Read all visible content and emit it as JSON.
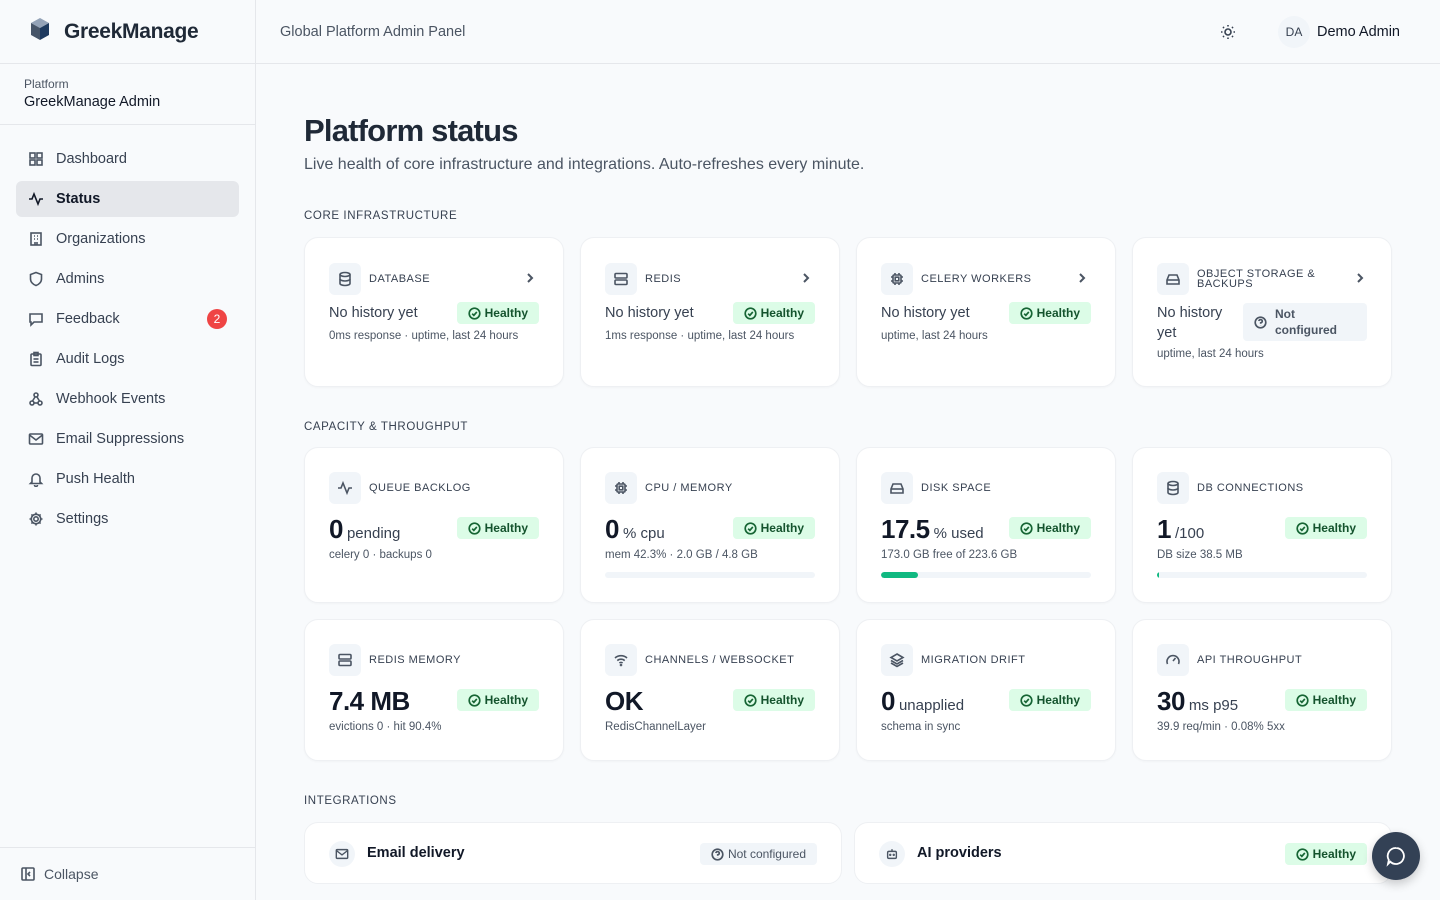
{
  "app": {
    "brand": "GreekManage",
    "org_label": "Platform",
    "org_name": "GreekManage Admin"
  },
  "sidebar": {
    "items": [
      {
        "label": "Dashboard",
        "icon": "grid-icon"
      },
      {
        "label": "Status",
        "icon": "activity-icon",
        "active": true
      },
      {
        "label": "Organizations",
        "icon": "building-icon"
      },
      {
        "label": "Admins",
        "icon": "shield-icon"
      },
      {
        "label": "Feedback",
        "icon": "message-icon",
        "badge": "2"
      },
      {
        "label": "Audit Logs",
        "icon": "clipboard-icon"
      },
      {
        "label": "Webhook Events",
        "icon": "webhook-icon"
      },
      {
        "label": "Email Suppressions",
        "icon": "mail-x-icon"
      },
      {
        "label": "Push Health",
        "icon": "bell-icon"
      },
      {
        "label": "Settings",
        "icon": "gear-icon"
      }
    ],
    "collapse_label": "Collapse"
  },
  "header": {
    "title": "Global Platform Admin Panel",
    "avatar_initials": "DA",
    "user_name": "Demo Admin"
  },
  "page": {
    "title": "Platform status",
    "subtitle": "Live health of core infrastructure and integrations. Auto-refreshes every minute."
  },
  "sections": {
    "core": "CORE INFRASTRUCTURE",
    "capacity": "CAPACITY & THROUGHPUT",
    "integrations": "INTEGRATIONS"
  },
  "core_cards": [
    {
      "label": "DATABASE",
      "status_text": "No history yet",
      "pill": "Healthy",
      "detail": "0ms response · uptime, last 24 hours"
    },
    {
      "label": "REDIS",
      "status_text": "No history yet",
      "pill": "Healthy",
      "detail": "1ms response · uptime, last 24 hours"
    },
    {
      "label": "CELERY WORKERS",
      "status_text": "No history yet",
      "pill": "Healthy",
      "detail": "uptime, last 24 hours"
    },
    {
      "label_line1": "OBJECT STORAGE &",
      "label_line2": "BACKUPS",
      "status_line1": "No history",
      "status_line2": "yet",
      "pill_line1": "Not",
      "pill_line2": "configured",
      "detail": "uptime, last 24 hours"
    }
  ],
  "capacity_cards": [
    {
      "label": "QUEUE BACKLOG",
      "value": "0",
      "unit": "pending",
      "pill": "Healthy",
      "detail": "celery 0 · backups 0"
    },
    {
      "label": "CPU / MEMORY",
      "value": "0",
      "unit": "% cpu",
      "pill": "Healthy",
      "detail": "mem 42.3% · 2.0 GB / 4.8 GB",
      "bar_fraction": 0.0
    },
    {
      "label": "DISK SPACE",
      "value": "17.5",
      "unit": "% used",
      "pill": "Healthy",
      "detail": "173.0 GB free of 223.6 GB",
      "bar_fraction": 0.175
    },
    {
      "label": "DB CONNECTIONS",
      "value": "1",
      "unit": "/100",
      "pill": "Healthy",
      "detail": "DB size 38.5 MB",
      "bar_fraction": 0.01
    },
    {
      "label": "REDIS MEMORY",
      "value": "7.4 MB",
      "unit": "",
      "pill": "Healthy",
      "detail": "evictions 0 · hit 90.4%"
    },
    {
      "label": "CHANNELS / WEBSOCKET",
      "value": "OK",
      "unit": "",
      "pill": "Healthy",
      "detail": "RedisChannelLayer"
    },
    {
      "label": "MIGRATION DRIFT",
      "value": "0",
      "unit": "unapplied",
      "pill": "Healthy",
      "detail": "schema in sync"
    },
    {
      "label": "API THROUGHPUT",
      "value": "30",
      "unit": "ms p95",
      "pill": "Healthy",
      "detail": "39.9 req/min · 0.08% 5xx"
    }
  ],
  "integrations": [
    {
      "name": "Email delivery",
      "pill": "Not configured"
    },
    {
      "name": "AI providers",
      "pill": "Healthy"
    }
  ],
  "colors": {
    "accent_green": "#10b981",
    "pill_green_bg": "#dcfce7",
    "badge_red": "#ef4444",
    "fab": "#334155"
  }
}
